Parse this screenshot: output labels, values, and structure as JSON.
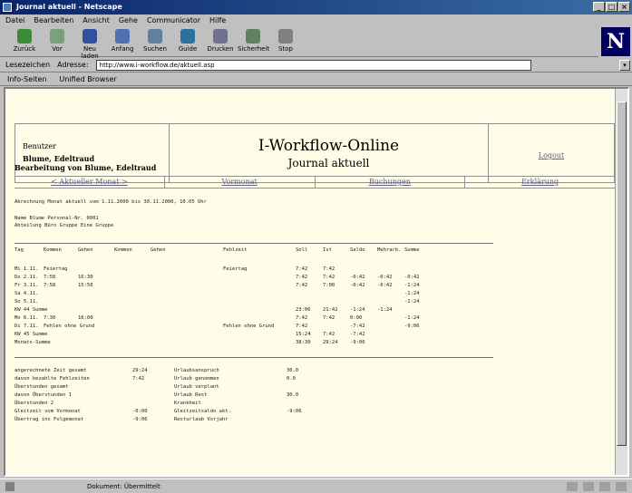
{
  "window": {
    "title": "Journal aktuell - Netscape"
  },
  "menu": [
    "Datei",
    "Bearbeiten",
    "Ansicht",
    "Gehe",
    "Communicator",
    "Hilfe"
  ],
  "toolbar": [
    {
      "label": "Zurück",
      "icon": "back-arrow-icon",
      "color": "#3a8a3a"
    },
    {
      "label": "Vor",
      "icon": "forward-arrow-icon",
      "color": "#7aa07a"
    },
    {
      "label": "Neu laden",
      "icon": "reload-icon",
      "color": "#3050a0"
    },
    {
      "label": "Anfang",
      "icon": "home-icon",
      "color": "#5070b0"
    },
    {
      "label": "Suchen",
      "icon": "search-icon",
      "color": "#6080a0"
    },
    {
      "label": "Guide",
      "icon": "guide-icon",
      "color": "#3070a0"
    },
    {
      "label": "Drucken",
      "icon": "print-icon",
      "color": "#707090"
    },
    {
      "label": "Sicherheit",
      "icon": "lock-icon",
      "color": "#608060"
    },
    {
      "label": "Stop",
      "icon": "stop-icon",
      "color": "#808080"
    }
  ],
  "location": {
    "bookmarks": "Lesezeichen",
    "label": "Adresse:",
    "url": "http://www.i-workflow.de/aktuell.asp"
  },
  "personal": [
    "Info-Seiten",
    "Unified Browser"
  ],
  "header": {
    "user_label": "Benutzer",
    "user_name": "Blume, Edeltraud",
    "title": "I-Workflow-Online",
    "subtitle": "Journal aktuell",
    "logout": "Logout"
  },
  "section_title": "Bearbeitung von Blume, Edeltraud",
  "nav": [
    "< Aktueller Monat >",
    "Vormonat",
    "Buchungen",
    "Erklärung"
  ],
  "info_lines": [
    "Abrechnung Monat aktuell vom  1.11.2000  bis  30.11.2000, 10.05 Uhr",
    "Name           Blume                 Personal-Nr.    0001",
    "Abteilung      Büro                  Gruppe          Eine Gruppe"
  ],
  "table": {
    "headers": [
      "Tag",
      "Kommen",
      "Gehen",
      "Kommen",
      "Gehen",
      "Fehlzeit",
      "Soll",
      "Ist",
      "Saldo",
      "Mehrarb.",
      "Summe"
    ],
    "rows": [
      [
        "Mi 1.11.",
        "Feiertag",
        "",
        "",
        "",
        "Feiertag",
        "7:42",
        "7:42",
        "",
        "",
        ""
      ],
      [
        "Do 2.11.",
        "7:58",
        "16:30",
        "",
        "",
        "",
        "7:42",
        "7:42",
        "-0:42",
        "-0:42",
        "-0:42"
      ],
      [
        "Fr 3.11.",
        "7:58",
        "15:50",
        "",
        "",
        "",
        "7:42",
        "7:00",
        "-0:42",
        "-0:42",
        "-1:24"
      ],
      [
        "Sa 4.11.",
        "",
        "",
        "",
        "",
        "",
        "",
        "",
        "",
        "",
        "-1:24"
      ],
      [
        "So 5.11.",
        "",
        "",
        "",
        "",
        "",
        "",
        "",
        "",
        "",
        "-1:24"
      ],
      [
        "KW 44 Summe",
        "",
        "",
        "",
        "",
        "",
        "23:06",
        "21:42",
        "-1:24",
        "-1:24",
        ""
      ],
      [
        "Mo 6.11.",
        "7:30",
        "16:00",
        "",
        "",
        "",
        "7:42",
        "7:42",
        "0:00",
        "",
        "-1:24"
      ],
      [
        "Di 7.11.",
        "Fehlen ohne Grund",
        "",
        "",
        "",
        "Fehlen ohne Grund",
        "7:42",
        "",
        "-7:42",
        "",
        "-9:06"
      ],
      [
        "KW 45 Summe",
        "",
        "",
        "",
        "",
        "",
        "15:24",
        "7:42",
        "-7:42",
        "",
        ""
      ],
      [
        "Monats-Summe",
        "",
        "",
        "",
        "",
        "",
        "38:30",
        "29:24",
        "-9:06",
        "",
        ""
      ]
    ]
  },
  "summary_left": [
    [
      "angerechnete Zeit gesamt",
      "29:24"
    ],
    [
      "davon bezahlte Fehlzeiten",
      "7:42"
    ],
    [
      "Überstunden gesamt",
      ""
    ],
    [
      "davon Überstunden 1",
      ""
    ],
    [
      "Überstunden 2",
      ""
    ],
    [
      "Gleitzeit vom Vormonat",
      "-0:00"
    ],
    [
      "Übertrag ins Folgemonat",
      "-9:06"
    ]
  ],
  "summary_right": [
    [
      "Urlaubsanspruch",
      "30.0"
    ],
    [
      "Urlaub genommen",
      "0.0"
    ],
    [
      "Urlaub verplant",
      ""
    ],
    [
      "Urlaub Rest",
      "30.0"
    ],
    [
      "Krankheit",
      ""
    ],
    [
      "Gleitzeitsaldo akt.",
      "-9:06"
    ],
    [
      "Resturlaub Vorjahr",
      ""
    ]
  ],
  "status": {
    "text": "Dokument: Übermittelt"
  }
}
